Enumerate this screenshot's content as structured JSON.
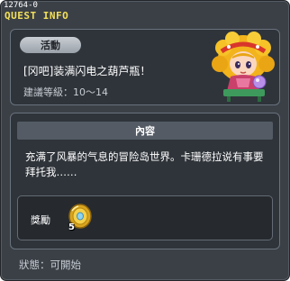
{
  "window": {
    "quest_id": "12764-0",
    "title": "QUEST INFO"
  },
  "quest": {
    "category": "活動",
    "title": "[冈吧]装满闪电之葫芦瓶！",
    "level_requirement": "建議等級：10～14",
    "content_header": "內容",
    "description": "充满了风暴的气息的冒险岛世界。卡珊德拉说有事要拜托我……",
    "reward_label": "獎勵",
    "reward_item_icon": "gold-coin-icon",
    "reward_item_count": "5",
    "status": "狀態：可開始"
  },
  "colors": {
    "window_bg": "#3b4047",
    "title_yellow": "#f3e05a",
    "panel_bg": "#2f343a",
    "header_bar": "#545b64"
  }
}
